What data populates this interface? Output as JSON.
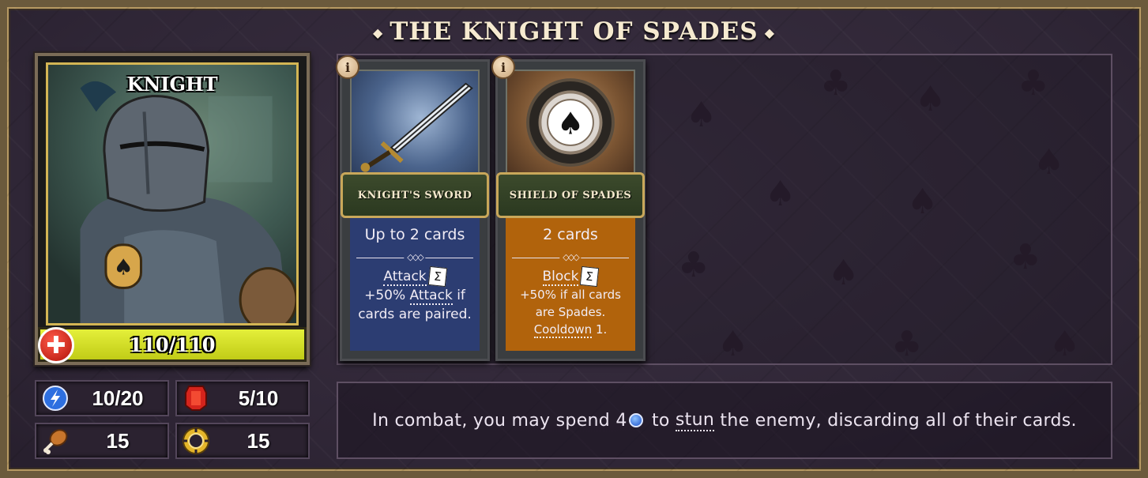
{
  "title": "THE KNIGHT OF SPADES",
  "portrait": {
    "name": "KNIGHT",
    "hp": "110/110"
  },
  "stats": {
    "energy": "10/20",
    "gems": "5/10",
    "food": "15",
    "gold": "15"
  },
  "cards": [
    {
      "name": "KNIGHT'S SWORD",
      "cost": "Up to 2 cards",
      "effect_keyword": "Attack",
      "effect_line1": "+50%",
      "effect_keyword2": "Attack",
      "effect_line2": "if",
      "effect_line3": "cards are paired."
    },
    {
      "name": "SHIELD OF SPADES",
      "cost": "2 cards",
      "effect_keyword": "Block",
      "effect_line1": "+50% if all cards are Spades.",
      "effect_keyword2": "Cooldown",
      "effect_line2": "1."
    }
  ],
  "description": {
    "part1": "In combat, you may spend 4",
    "part2": "to",
    "keyword": "stun",
    "part3": "the enemy, discarding all of their cards."
  },
  "colors": {
    "sword_body": "#2c3d72",
    "shield_body": "#b1630c",
    "hp_bar": "#d9e42a"
  }
}
